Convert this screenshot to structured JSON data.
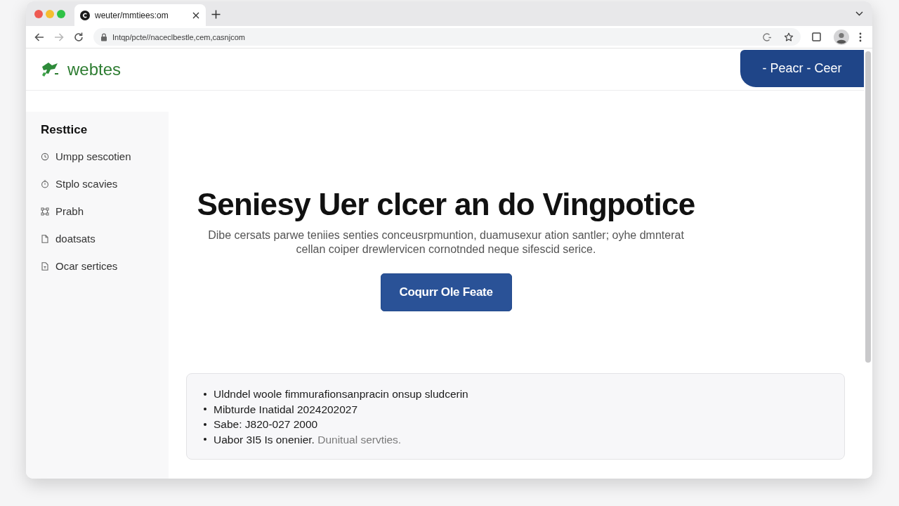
{
  "browser": {
    "tabs": [
      {
        "title": "weuter/mmtiees:om",
        "selected": true
      }
    ],
    "forward_button": {
      "disabled": true
    },
    "address": "Intqp/pcte//naceclbestle,cem,casnjcom"
  },
  "header": {
    "logo": "webtes",
    "cta_button": "- Peacr - Ceer"
  },
  "sidebar": {
    "title": "Resttice",
    "items": [
      "Umpp sescotien",
      "Stplo scavies",
      "Prabh",
      "doatsats",
      "Ocar sertices"
    ]
  },
  "hero": {
    "heading": "Seniesy Uer clcer an do Vingpotice",
    "text": "Dibe cersats parwe teniies senties conceusrpmuntion, duamusexur ation santler; oyhe dmnterat cellan coiper drewlervicen cornotnded neque sifescid serice.",
    "button": "Coqurr Ole Feate"
  },
  "info_box": {
    "items": [
      {
        "text": "Uldndel woole fimmurafionsanpracin onsup sludcerin"
      },
      {
        "text": "Mibturde Inatidal 2024202027"
      },
      {
        "text": "Sabe: J820-027 2000"
      },
      {
        "text": "Uabor 3I5 Is onenier.",
        "note": "Dunitual servties."
      }
    ]
  }
}
